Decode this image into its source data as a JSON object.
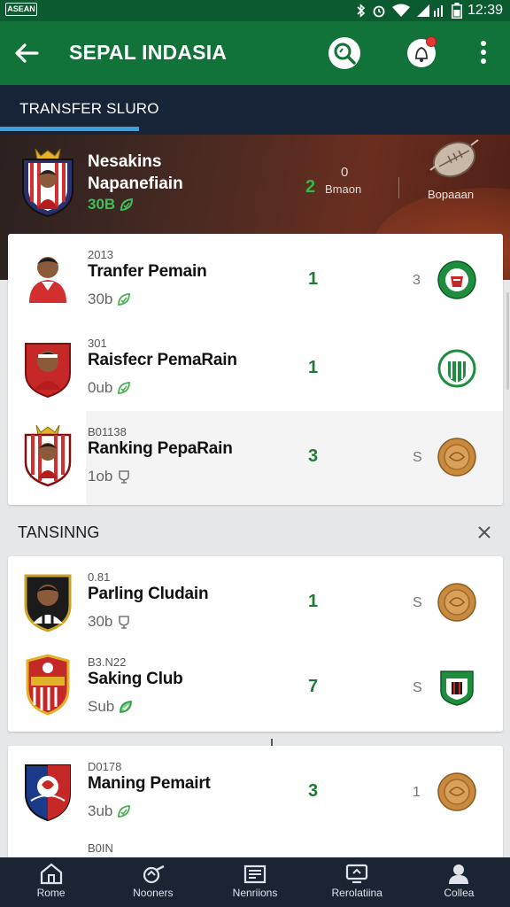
{
  "status_bar": {
    "badge": "ASEAN",
    "time": "12:39",
    "icons": [
      "bluetooth-icon",
      "alarm-icon",
      "wifi-icon",
      "signal-icon",
      "battery-icon"
    ]
  },
  "app_bar": {
    "title": "SEPAL INDASIA",
    "icons": [
      "back-arrow-icon",
      "search-icon",
      "bell-icon",
      "more-vert-icon"
    ]
  },
  "tab": {
    "label": "TRANSFER SLURO"
  },
  "hero": {
    "name_line1": "Nesakins",
    "name_line2": "Napanefiain",
    "sub": "30B",
    "stat_value": "2",
    "stat_zero": "0",
    "stat_label": "Bmaon",
    "ball_label": "Bopaaan"
  },
  "card1": {
    "rows": [
      {
        "id": "2013",
        "name": "Tranfer Pemain",
        "sub": "30b",
        "value": "1",
        "mark": "3",
        "badge": "green-club-badge"
      },
      {
        "id": "301",
        "name": "Raisfecr PemaRain",
        "sub": "0ub",
        "value": "1",
        "mark": "",
        "badge": "green-striped-badge"
      },
      {
        "id": "B01138",
        "name": "Ranking PepaRain",
        "sub": "1ob",
        "value": "3",
        "mark": "S",
        "badge": "bronze-medal"
      }
    ]
  },
  "section": {
    "title": "TANSINNG"
  },
  "card2": {
    "rows": [
      {
        "id": "0.81",
        "name": "Parling Cludain",
        "sub": "30b",
        "value": "1",
        "mark": "S",
        "badge": "bronze-medal"
      },
      {
        "id": "B3.N22",
        "name": "Saking Club",
        "sub": "Sub",
        "value": "7",
        "mark": "S",
        "badge": "green-shield-badge"
      }
    ]
  },
  "card3": {
    "rows": [
      {
        "id": "D0178",
        "name": "Maning Pemairt",
        "sub": "3ub",
        "value": "3",
        "mark": "1",
        "badge": "bronze-medal"
      },
      {
        "id": "B0IN"
      }
    ]
  },
  "bottom_nav": {
    "items": [
      {
        "label": "Rome",
        "icon": "home-icon"
      },
      {
        "label": "Nooners",
        "icon": "whistle-icon"
      },
      {
        "label": "Nenriions",
        "icon": "news-icon"
      },
      {
        "label": "Rerolatiina",
        "icon": "tv-icon"
      },
      {
        "label": "Collea",
        "icon": "profile-icon"
      }
    ]
  },
  "colors": {
    "app_bar": "#11733a",
    "status_bar": "#0b5a30",
    "tab_strip": "#172336",
    "tab_underline": "#3ba0dc",
    "value_green": "#1f7a33",
    "bottom_nav": "#1b2433"
  }
}
